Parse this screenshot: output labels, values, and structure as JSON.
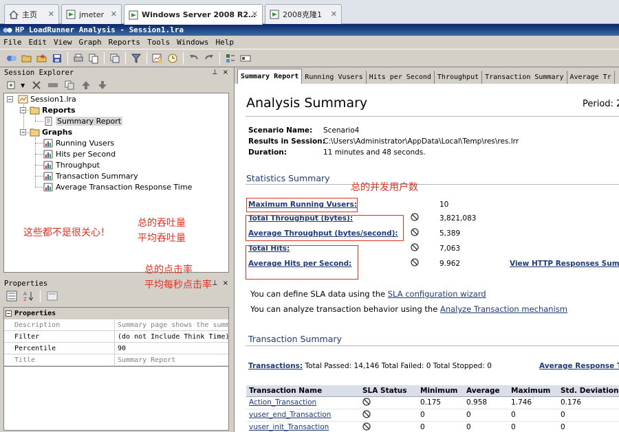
{
  "browser_tabs": [
    {
      "label": "主页",
      "icon": "home-icon"
    },
    {
      "label": "jmeter",
      "icon": "vm-icon"
    },
    {
      "label": "Windows Server 2008 R2 ...",
      "icon": "vm-icon",
      "active": true
    },
    {
      "label": "2008克隆1",
      "icon": "vm-icon"
    }
  ],
  "app_title": "HP LoadRunner Analysis - Session1.lra",
  "menu": [
    "File",
    "Edit",
    "View",
    "Graph",
    "Reports",
    "Tools",
    "Windows",
    "Help"
  ],
  "session_explorer": {
    "title": "Session Explorer",
    "pin": "📌",
    "close": "×",
    "root": "Session1.lra",
    "reports_folder": "Reports",
    "reports": [
      "Summary Report"
    ],
    "graphs_folder": "Graphs",
    "graphs": [
      "Running Vusers",
      "Hits per Second",
      "Throughput",
      "Transaction Summary",
      "Average Transaction Response Time"
    ]
  },
  "properties": {
    "title": "Properties",
    "category": "Properties",
    "rows": [
      {
        "key": "Description",
        "value": "Summary page shows the summ",
        "gray": true
      },
      {
        "key": "Filter",
        "value": "(do not Include Think Time)",
        "gray": false
      },
      {
        "key": "Percentile",
        "value": "90",
        "gray": false
      },
      {
        "key": "Title",
        "value": "Summary Report",
        "gray": true
      }
    ]
  },
  "report_tabs": [
    "Summary Report",
    "Running Vusers",
    "Hits per Second",
    "Throughput",
    "Transaction Summary",
    "Average Tr"
  ],
  "report": {
    "title": "Analysis Summary",
    "period": "Period: 2",
    "scenario_label": "Scenario Name:",
    "scenario_value": "Scenario4",
    "results_label": "Results in Session:",
    "results_value": "C:\\Users\\Administrator\\AppData\\Local\\Temp\\res\\res.lrr",
    "duration_label": "Duration:",
    "duration_value": "11 minutes and 48 seconds.",
    "stats_title": "Statistics Summary",
    "stats": [
      {
        "label": "Maximum Running Vusers:",
        "value": "10",
        "icon": false
      },
      {
        "label": "Total Throughput (bytes):",
        "value": "3,821,083",
        "icon": true
      },
      {
        "label": "Average Throughput (bytes/second):",
        "value": "5,389",
        "icon": true
      },
      {
        "label": "Total Hits:",
        "value": "7,063",
        "icon": true
      },
      {
        "label": "Average Hits per Second:",
        "value": "9.962",
        "icon": true
      }
    ],
    "http_link": "View HTTP Responses Summ",
    "sla_line_prefix": "You can define SLA data using the ",
    "sla_link": "SLA configuration wizard",
    "analyze_line_prefix": "You can analyze transaction behavior using the ",
    "analyze_link": "Analyze Transaction mechanism",
    "transaction_title": "Transaction Summary",
    "transactions_label": "Transactions:",
    "transactions_text": " Total Passed: 14,146 Total Failed: 0 Total Stopped: 0",
    "avg_response_link": "Average Response T",
    "table_headers": [
      "Transaction Name",
      "SLA Status",
      "Minimum",
      "Average",
      "Maximum",
      "Std. Deviation"
    ],
    "table_rows": [
      {
        "name": "Action_Transaction",
        "min": "0.175",
        "avg": "0.958",
        "max": "1.746",
        "std": "0.176"
      },
      {
        "name": "vuser_end_Transaction",
        "min": "0",
        "avg": "0",
        "max": "0",
        "std": "0"
      },
      {
        "name": "vuser_init_Transaction",
        "min": "0",
        "avg": "0",
        "max": "0",
        "std": "0"
      }
    ]
  },
  "annotations": {
    "concurrent_users": "总的并发用户数",
    "not_care": "这些都不是很关心！",
    "throughput_1": "总的吞吐量",
    "throughput_2": "平均吞吐量",
    "hits_1": "总的点击率",
    "hits_2": "平均每秒点击率"
  },
  "colors": {
    "accent": "#1f3a78",
    "annotation": "#e03020",
    "titlebar": "#0a246a"
  }
}
